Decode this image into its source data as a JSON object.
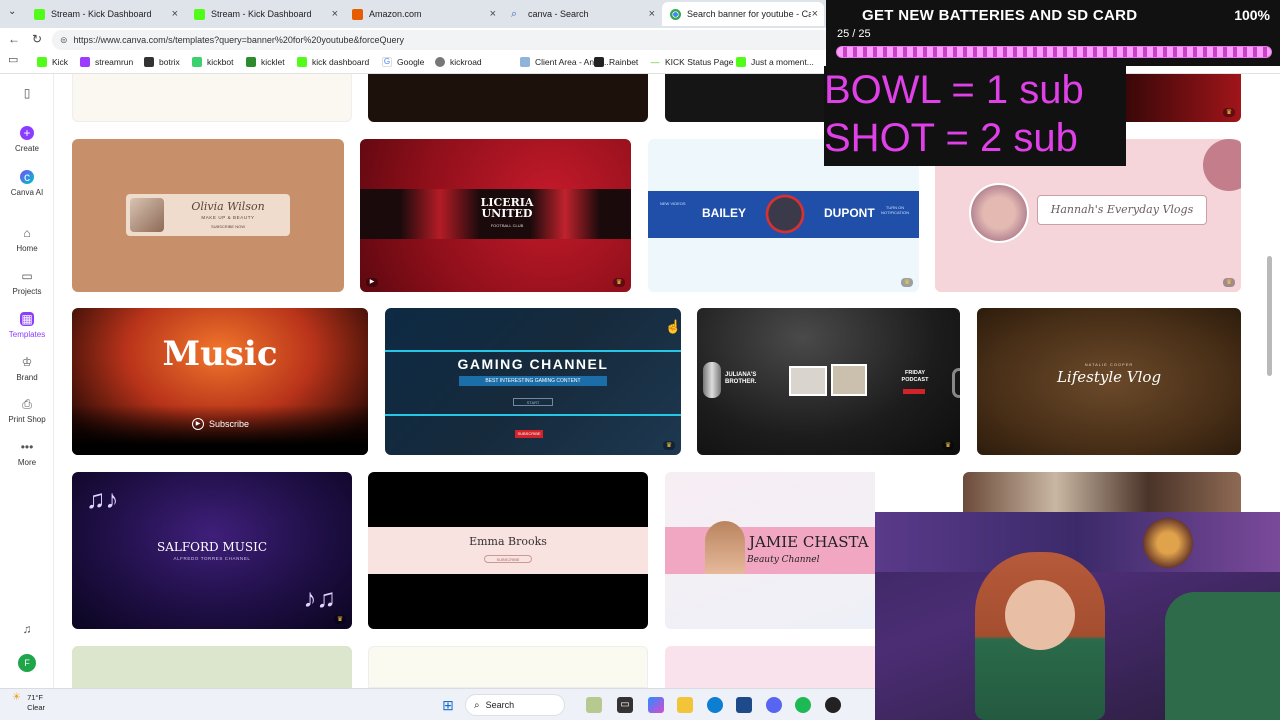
{
  "browser": {
    "tabs": [
      {
        "title": "Stream - Kick Dashboard",
        "icon": "kick-icon",
        "active": false
      },
      {
        "title": "Stream - Kick Dashboard",
        "icon": "kick-icon",
        "active": false
      },
      {
        "title": "Amazon.com",
        "icon": "amazon-icon",
        "active": false
      },
      {
        "title": "canva - Search",
        "icon": "search-icon",
        "active": false
      },
      {
        "title": "Search banner for youtube - Canva",
        "icon": "chrome-icon",
        "active": true
      }
    ],
    "url": "https://www.canva.com/s/templates?query=banner%20for%20youtube&forceQuery",
    "bookmarks": [
      "Kick",
      "streamrun",
      "botrix",
      "kickbot",
      "kicklet",
      "kick dashboard",
      "Google",
      "kickroad",
      "Client Area - AntiS...",
      "Rainbet",
      "KICK Status Page",
      "Just a moment..."
    ]
  },
  "sidebar": {
    "items": [
      {
        "label": "Create",
        "icon": "plus-icon"
      },
      {
        "label": "Canva AI",
        "icon": "canva-ai-icon"
      },
      {
        "label": "Home",
        "icon": "home-icon"
      },
      {
        "label": "Projects",
        "icon": "folder-icon"
      },
      {
        "label": "Templates",
        "icon": "templates-icon"
      },
      {
        "label": "Brand",
        "icon": "brand-icon"
      },
      {
        "label": "Print Shop",
        "icon": "print-icon"
      },
      {
        "label": "More",
        "icon": "more-icon"
      }
    ],
    "avatar_initial": "F"
  },
  "templates": {
    "olivia_name": "Olivia Wilson",
    "olivia_sub": "MAKE UP & BEAUTY",
    "olivia_cta": "SUBSCRIBE NOW",
    "liceria": "LICERIA UNITED",
    "liceria_sub": "FOOTBALL CLUB",
    "bailey": "BAILEY",
    "dupont": "DUPONT",
    "bailey_left": "NEW VIDEOS",
    "bailey_right": "TURN ON NOTIFICATION",
    "hannah": "Hannah's Everyday Vlogs",
    "music": "Music",
    "subscribe": "Subscribe",
    "gaming": "GAMING CHANNEL",
    "gaming_sub": "BEST INTERESTING GAMING CONTENT",
    "gaming_start": "START",
    "gaming_subscribe": "SUBSCRIBE",
    "juliana": "JULIANA'S BROTHER.",
    "podcast": "FRIDAY PODCAST",
    "lifestyle_name": "NATALIE COOPER",
    "lifestyle": "Lifestyle Vlog",
    "salford": "SALFORD MUSIC",
    "salford_sub": "ALFREDO TORRES CHANNEL",
    "emma": "Emma Brooks",
    "emma_cta": "SUBSCRIBE",
    "jamie": "JAMIE CHASTA",
    "jamie_sub": "Beauty Channel"
  },
  "overlay": {
    "goal_title": "GET NEW BATTERIES AND SD CARD",
    "goal_percent": "100%",
    "goal_count": "25 / 25",
    "goal_progress": 1.0,
    "bowl": "BOWL = 1 sub",
    "shot": "SHOT = 2 sub"
  },
  "taskbar": {
    "temp": "71°F",
    "weather": "Clear",
    "search": "Search"
  },
  "colors": {
    "canva_purple": "#8b3dff",
    "overlay_magenta": "#e040e8",
    "kick_green": "#53fc18"
  }
}
